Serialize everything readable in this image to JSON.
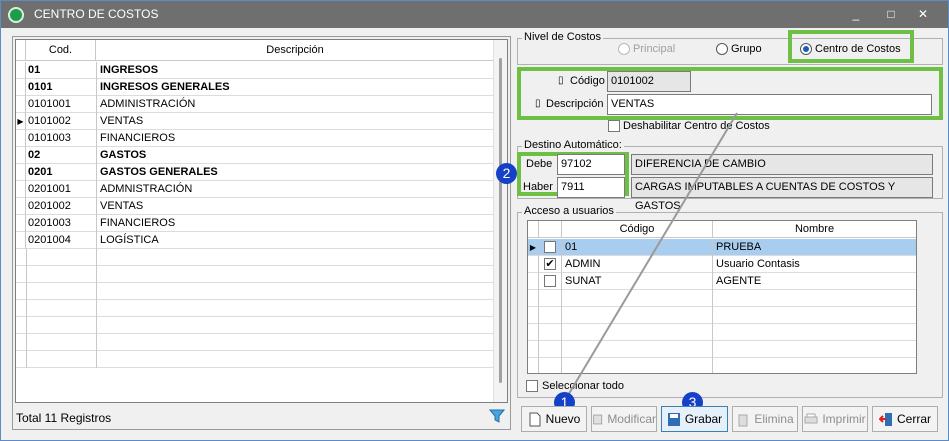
{
  "window": {
    "title": "CENTRO DE COSTOS",
    "minimize": "_",
    "maximize": "□",
    "close": "✕"
  },
  "list": {
    "headers": {
      "cod": "Cod.",
      "desc": "Descripción"
    },
    "rows": [
      {
        "cod": "01",
        "desc": "INGRESOS",
        "bold": true
      },
      {
        "cod": "0101",
        "desc": "INGRESOS GENERALES",
        "bold": true
      },
      {
        "cod": "0101001",
        "desc": "ADMINISTRACIÓN",
        "bold": false
      },
      {
        "cod": "0101002",
        "desc": "VENTAS",
        "bold": false,
        "current": true
      },
      {
        "cod": "0101003",
        "desc": "FINANCIEROS",
        "bold": false
      },
      {
        "cod": "02",
        "desc": "GASTOS",
        "bold": true
      },
      {
        "cod": "0201",
        "desc": "GASTOS GENERALES",
        "bold": true
      },
      {
        "cod": "0201001",
        "desc": "ADMNISTRACIÓN",
        "bold": false
      },
      {
        "cod": "0201002",
        "desc": "VENTAS",
        "bold": false
      },
      {
        "cod": "0201003",
        "desc": "FINANCIEROS",
        "bold": false
      },
      {
        "cod": "0201004",
        "desc": "LOGÍSTICA",
        "bold": false
      }
    ],
    "total": "Total 11 Registros"
  },
  "nivel": {
    "label": "Nivel de Costos",
    "options": [
      {
        "label": "Principal",
        "selected": false,
        "disabled": true
      },
      {
        "label": "Grupo",
        "selected": false,
        "disabled": false
      },
      {
        "label": "Centro de Costos",
        "selected": true,
        "disabled": false
      }
    ]
  },
  "form": {
    "codigo_label": "Código",
    "codigo_value": "0101002",
    "descripcion_label": "Descripción",
    "descripcion_value": "VENTAS",
    "deshabilitar_label": "Deshabilitar Centro de Costos",
    "deshabilitar_checked": false
  },
  "destino": {
    "label": "Destino Automático:",
    "debe_label": "Debe",
    "debe_value": "97102",
    "debe_desc": "DIFERENCIA DE CAMBIO",
    "haber_label": "Haber",
    "haber_value": "7911",
    "haber_desc": "CARGAS IMPUTABLES A CUENTAS DE COSTOS Y GASTOS"
  },
  "acceso": {
    "label": "Acceso a usuarios",
    "headers": {
      "codigo": "Código",
      "nombre": "Nombre"
    },
    "rows": [
      {
        "codigo": "01",
        "nombre": "PRUEBA",
        "checked": false,
        "selected": true
      },
      {
        "codigo": "ADMIN",
        "nombre": "Usuario Contasis",
        "checked": true,
        "selected": false
      },
      {
        "codigo": "SUNAT",
        "nombre": "AGENTE",
        "checked": false,
        "selected": false
      }
    ],
    "select_all_label": "Seleccionar todo"
  },
  "buttons": {
    "nuevo": "Nuevo",
    "modificar": "Modificar",
    "grabar": "Grabar",
    "elimina": "Elimina",
    "imprimir": "Imprimir",
    "cerrar": "Cerrar"
  },
  "badges": {
    "one": "1",
    "two": "2",
    "three": "3"
  },
  "colors": {
    "highlight": "#6dc044",
    "badge": "#1441c8",
    "selected_row": "#a8cdee",
    "titlebar": "#6f6f6f"
  }
}
